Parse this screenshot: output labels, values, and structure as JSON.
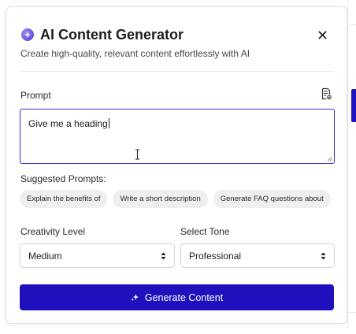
{
  "dialog": {
    "title": "AI Content Generator",
    "subtitle": "Create high-quality, relevant content effortlessly with AI",
    "title_icon": "sparkle-icon",
    "close_icon": "close-icon"
  },
  "prompt": {
    "label": "Prompt",
    "value": "Give me a heading",
    "template_icon": "document-template-icon"
  },
  "suggested": {
    "label": "Suggested Prompts:",
    "items": [
      "Explain the benefits of",
      "Write a short description",
      "Generate FAQ questions about"
    ]
  },
  "creativity": {
    "label": "Creativity Level",
    "selected": "Medium"
  },
  "tone": {
    "label": "Select Tone",
    "selected": "Professional"
  },
  "generate_button": {
    "label": "Generate Content",
    "icon": "sparkle-icon"
  },
  "colors": {
    "accent": "#1f0fbd",
    "focus_border": "#3a2fd0",
    "chip_bg": "#efefef"
  }
}
